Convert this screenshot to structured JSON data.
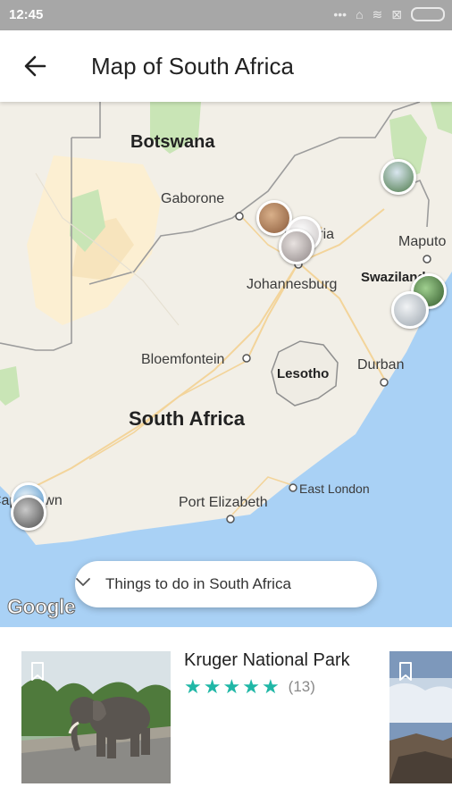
{
  "status_bar": {
    "time": "12:45",
    "icons": [
      "more-dots-icon",
      "silent-icon",
      "wifi-icon",
      "close-box-icon",
      "battery-icon"
    ]
  },
  "header": {
    "title": "Map of South Africa"
  },
  "map": {
    "labels": {
      "botswana": "Botswana",
      "gaborone": "Gaborone",
      "pretoria": "Pretoria",
      "maputo": "Maputo",
      "johannesburg": "Johannesburg",
      "swaziland": "Swaziland",
      "bloemfontein": "Bloemfontein",
      "lesotho": "Lesotho",
      "durban": "Durban",
      "south_africa": "South Africa",
      "port_elizabeth": "Port Elizabeth",
      "east_london": "East London",
      "cape_town": "Cape Town"
    },
    "google_logo": "Google",
    "filter_label": "Things to do in South Africa"
  },
  "cards": [
    {
      "name": "Kruger National Park",
      "rating": 5,
      "review_count": "(13)"
    }
  ],
  "colors": {
    "land": "#f2efe7",
    "desert": "#fcefd2",
    "park": "#c9e5b6",
    "water": "#a9d1f5",
    "star": "#20b7a6"
  }
}
